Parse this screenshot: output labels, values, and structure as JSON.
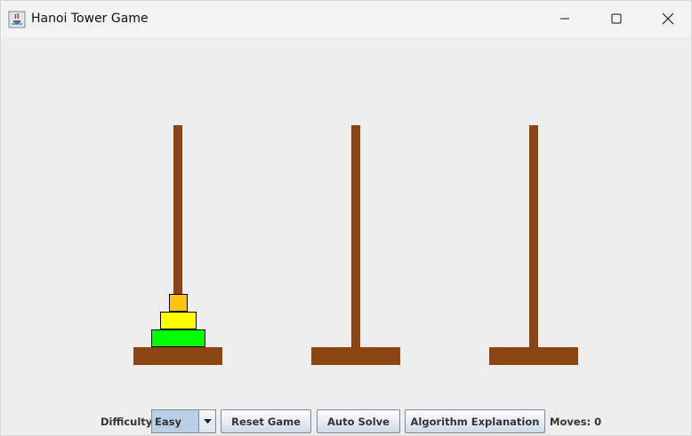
{
  "window": {
    "title": "Hanoi Tower Game",
    "app_icon": "java-cup-icon",
    "controls": [
      "minimize-icon",
      "maximize-icon",
      "close-icon"
    ]
  },
  "game": {
    "pegs": 3,
    "colors": {
      "peg": "#8b4513",
      "disk_small": "#ffc20e",
      "disk_medium": "#ffff00",
      "disk_large": "#00ff00",
      "disk_border": "#000000",
      "background": "#eeeeee"
    },
    "towers": [
      {
        "name": "peg-1",
        "disks_bottom_to_top": [
          "large",
          "medium",
          "small"
        ]
      },
      {
        "name": "peg-2",
        "disks_bottom_to_top": []
      },
      {
        "name": "peg-3",
        "disks_bottom_to_top": []
      }
    ]
  },
  "controls": {
    "difficulty_label": "Difficulty:",
    "difficulty_value": "Easy",
    "reset_label": "Reset Game",
    "auto_solve_label": "Auto Solve",
    "algorithm_label": "Algorithm Explanation",
    "moves_label": "Moves: 0"
  }
}
